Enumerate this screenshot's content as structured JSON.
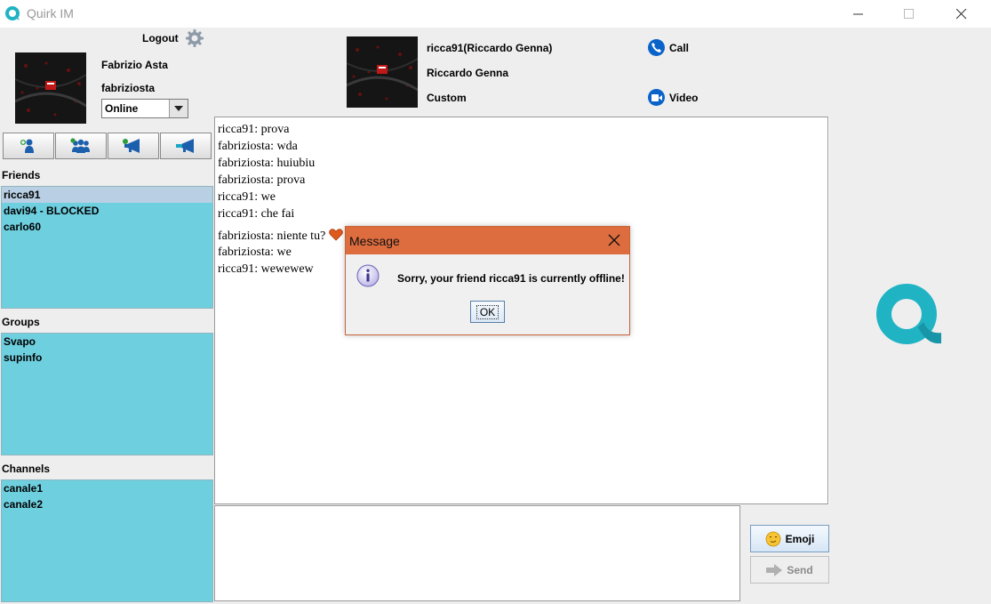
{
  "window": {
    "title": "Quirk IM"
  },
  "user": {
    "logout": "Logout",
    "full_name": "Fabrizio Asta",
    "username": "fabriziosta",
    "status": "Online"
  },
  "toolbar": {
    "icons": [
      "add-friend-icon",
      "add-group-icon",
      "add-channel-icon",
      "broadcast-icon"
    ]
  },
  "friends": {
    "label": "Friends",
    "items": [
      {
        "name": "ricca91",
        "selected": true
      },
      {
        "name": "davi94 - BLOCKED",
        "selected": false
      },
      {
        "name": "carlo60",
        "selected": false
      }
    ]
  },
  "groups": {
    "label": "Groups",
    "items": [
      {
        "name": "Svapo"
      },
      {
        "name": "supinfo"
      }
    ]
  },
  "channels": {
    "label": "Channels",
    "items": [
      {
        "name": "canale1"
      },
      {
        "name": "canale2"
      }
    ]
  },
  "contact": {
    "id_line": "ricca91(Riccardo Genna)",
    "name": "Riccardo Genna",
    "status": "Custom",
    "call": "Call",
    "video": "Video"
  },
  "messages": [
    {
      "text": "ricca91: prova"
    },
    {
      "text": "fabriziosta: wda"
    },
    {
      "text": "fabriziosta: huiubiu"
    },
    {
      "text": "fabriziosta: prova"
    },
    {
      "text": "ricca91: we"
    },
    {
      "text": "ricca91: che fai"
    },
    {
      "text": "fabriziosta: niente tu?",
      "emoji": "heart-emoji"
    },
    {
      "text": "fabriziosta: we"
    },
    {
      "text": "ricca91: wewewew"
    }
  ],
  "composer": {
    "value": "",
    "emoji_button": "Emoji",
    "send_button": "Send"
  },
  "dialog": {
    "title": "Message",
    "text": "Sorry, your friend ricca91 is currently offline!",
    "ok": "OK"
  },
  "colors": {
    "list_bg": "#6ecfdf",
    "selection": "#b8cfe4",
    "dialog_title": "#dd6c3e",
    "brand": "#1fb3c4"
  }
}
